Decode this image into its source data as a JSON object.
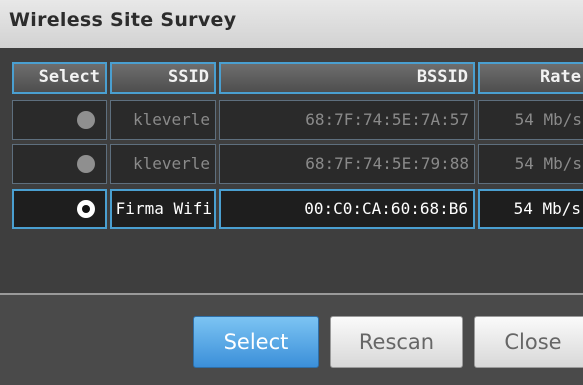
{
  "dialog": {
    "title": "Wireless Site Survey"
  },
  "table": {
    "columns": [
      "Select",
      "SSID",
      "BSSID",
      "Rate"
    ],
    "rows": [
      {
        "selected": false,
        "ssid": "kleverle",
        "bssid": "68:7F:74:5E:7A:57",
        "rate": "54 Mb/s"
      },
      {
        "selected": false,
        "ssid": "kleverle",
        "bssid": "68:7F:74:5E:79:88",
        "rate": "54 Mb/s"
      },
      {
        "selected": true,
        "ssid": "Firma Wifi",
        "bssid": "00:C0:CA:60:68:B6",
        "rate": "54 Mb/s"
      }
    ]
  },
  "buttons": {
    "select": "Select",
    "rescan": "Rescan",
    "close": "Close"
  }
}
